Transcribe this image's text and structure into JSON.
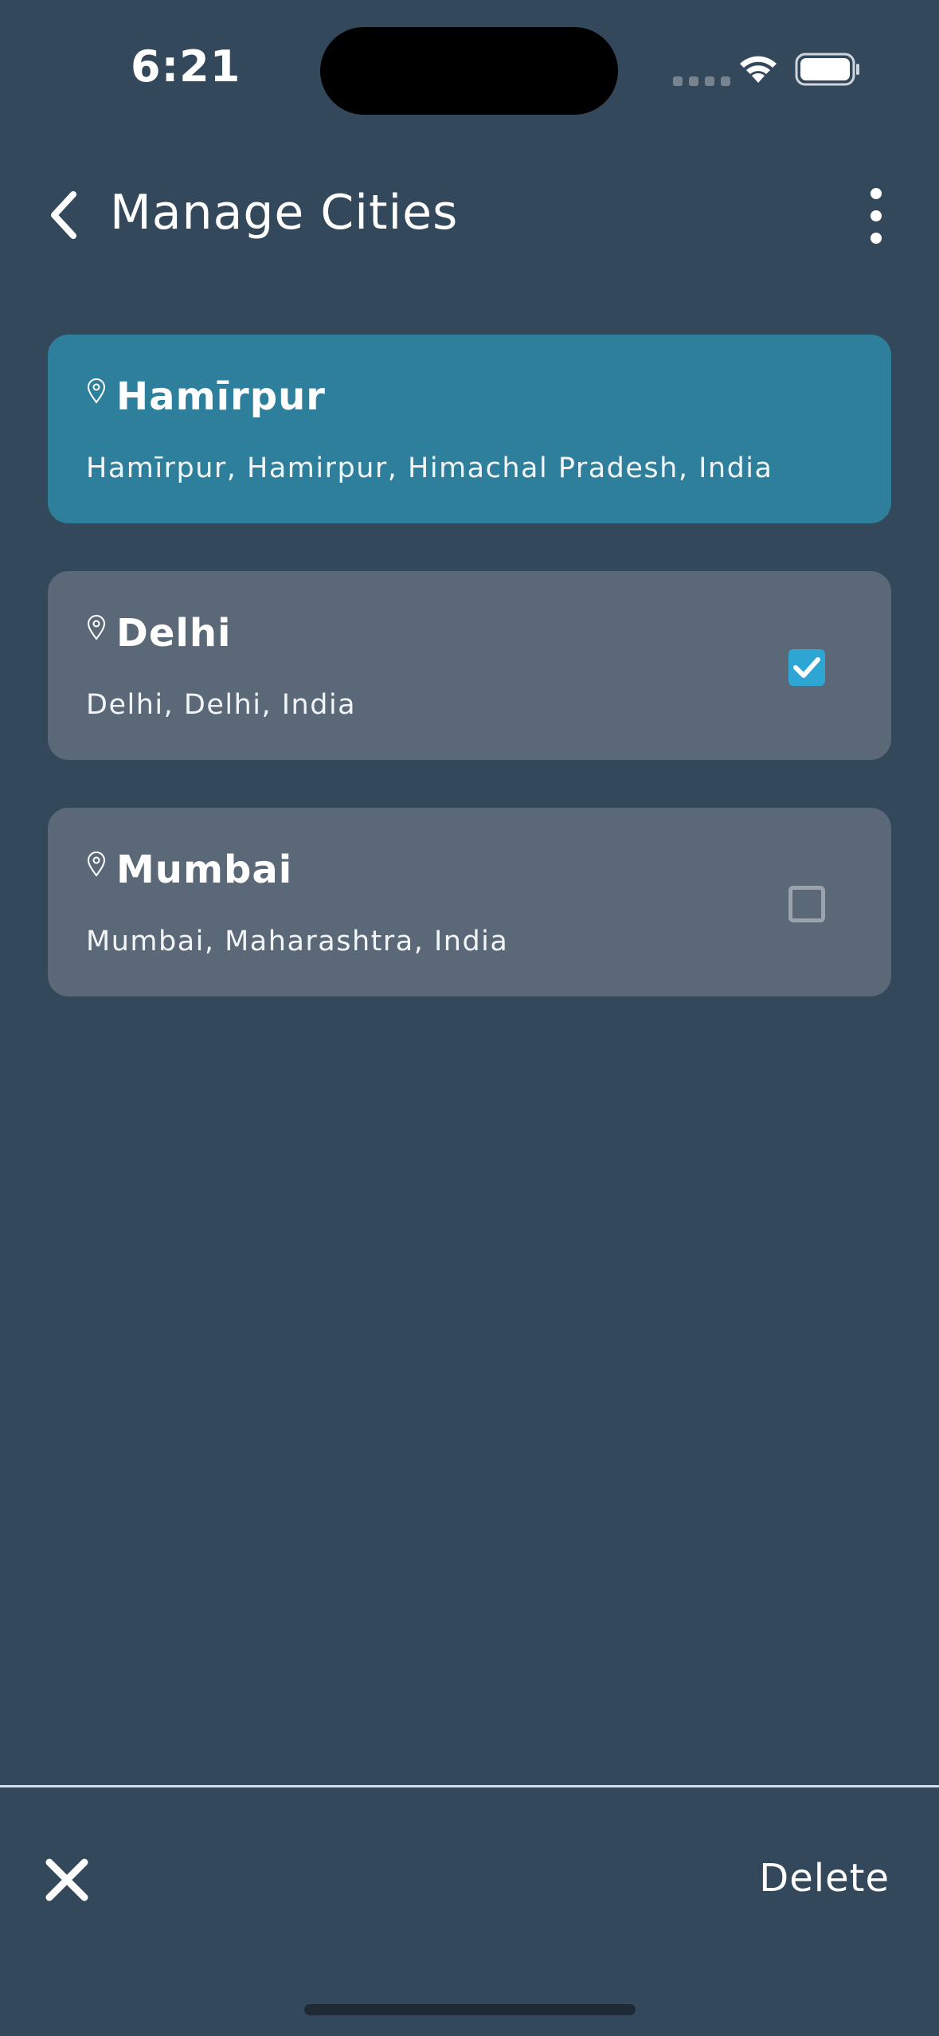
{
  "status": {
    "time": "6:21"
  },
  "header": {
    "title": "Manage Cities"
  },
  "cities": [
    {
      "name": "Hamīrpur",
      "details": "Hamīrpur,  Hamirpur,  Himachal Pradesh,  India",
      "selected": true
    },
    {
      "name": "Delhi",
      "details": "Delhi,  Delhi,  India",
      "checked": true
    },
    {
      "name": "Mumbai",
      "details": "Mumbai,  Maharashtra,  India",
      "checked": false
    }
  ],
  "footer": {
    "delete_label": "Delete"
  },
  "colors": {
    "background": "#34485c",
    "selected_card": "#2e7f9b",
    "card": "#5a6878",
    "checkbox_accent": "#2ea6d4"
  }
}
